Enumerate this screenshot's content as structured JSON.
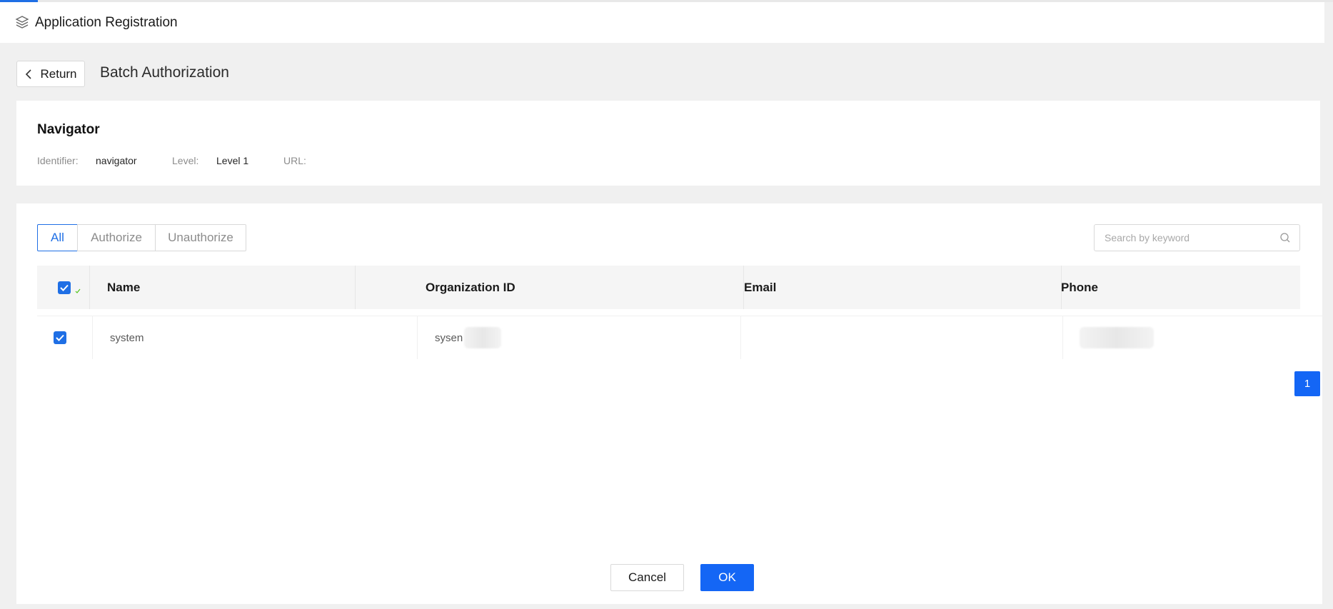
{
  "header": {
    "title": "Application Registration",
    "icon": "layers-icon"
  },
  "nav": {
    "return_label": "Return",
    "page_title": "Batch Authorization"
  },
  "app_info": {
    "name": "Navigator",
    "identifier_label": "Identifier:",
    "identifier_value": "navigator",
    "level_label": "Level:",
    "level_value": "Level 1",
    "url_label": "URL:",
    "url_value": ""
  },
  "filter_tabs": [
    "All",
    "Authorize",
    "Unauthorize"
  ],
  "filter_active": "All",
  "search": {
    "placeholder": "Search by keyword",
    "value": ""
  },
  "table": {
    "columns": [
      "Name",
      "Organization ID",
      "Email",
      "Phone"
    ],
    "header_checked": true,
    "rows": [
      {
        "checked": true,
        "name": "system",
        "organization_id": "sysen",
        "email": "",
        "phone": ""
      }
    ]
  },
  "pagination": {
    "current_page": "1"
  },
  "actions": {
    "cancel_label": "Cancel",
    "ok_label": "OK"
  },
  "colors": {
    "accent": "#1f6fe5",
    "primary_button": "#1466f5",
    "page_bg": "#f0f0f0"
  }
}
